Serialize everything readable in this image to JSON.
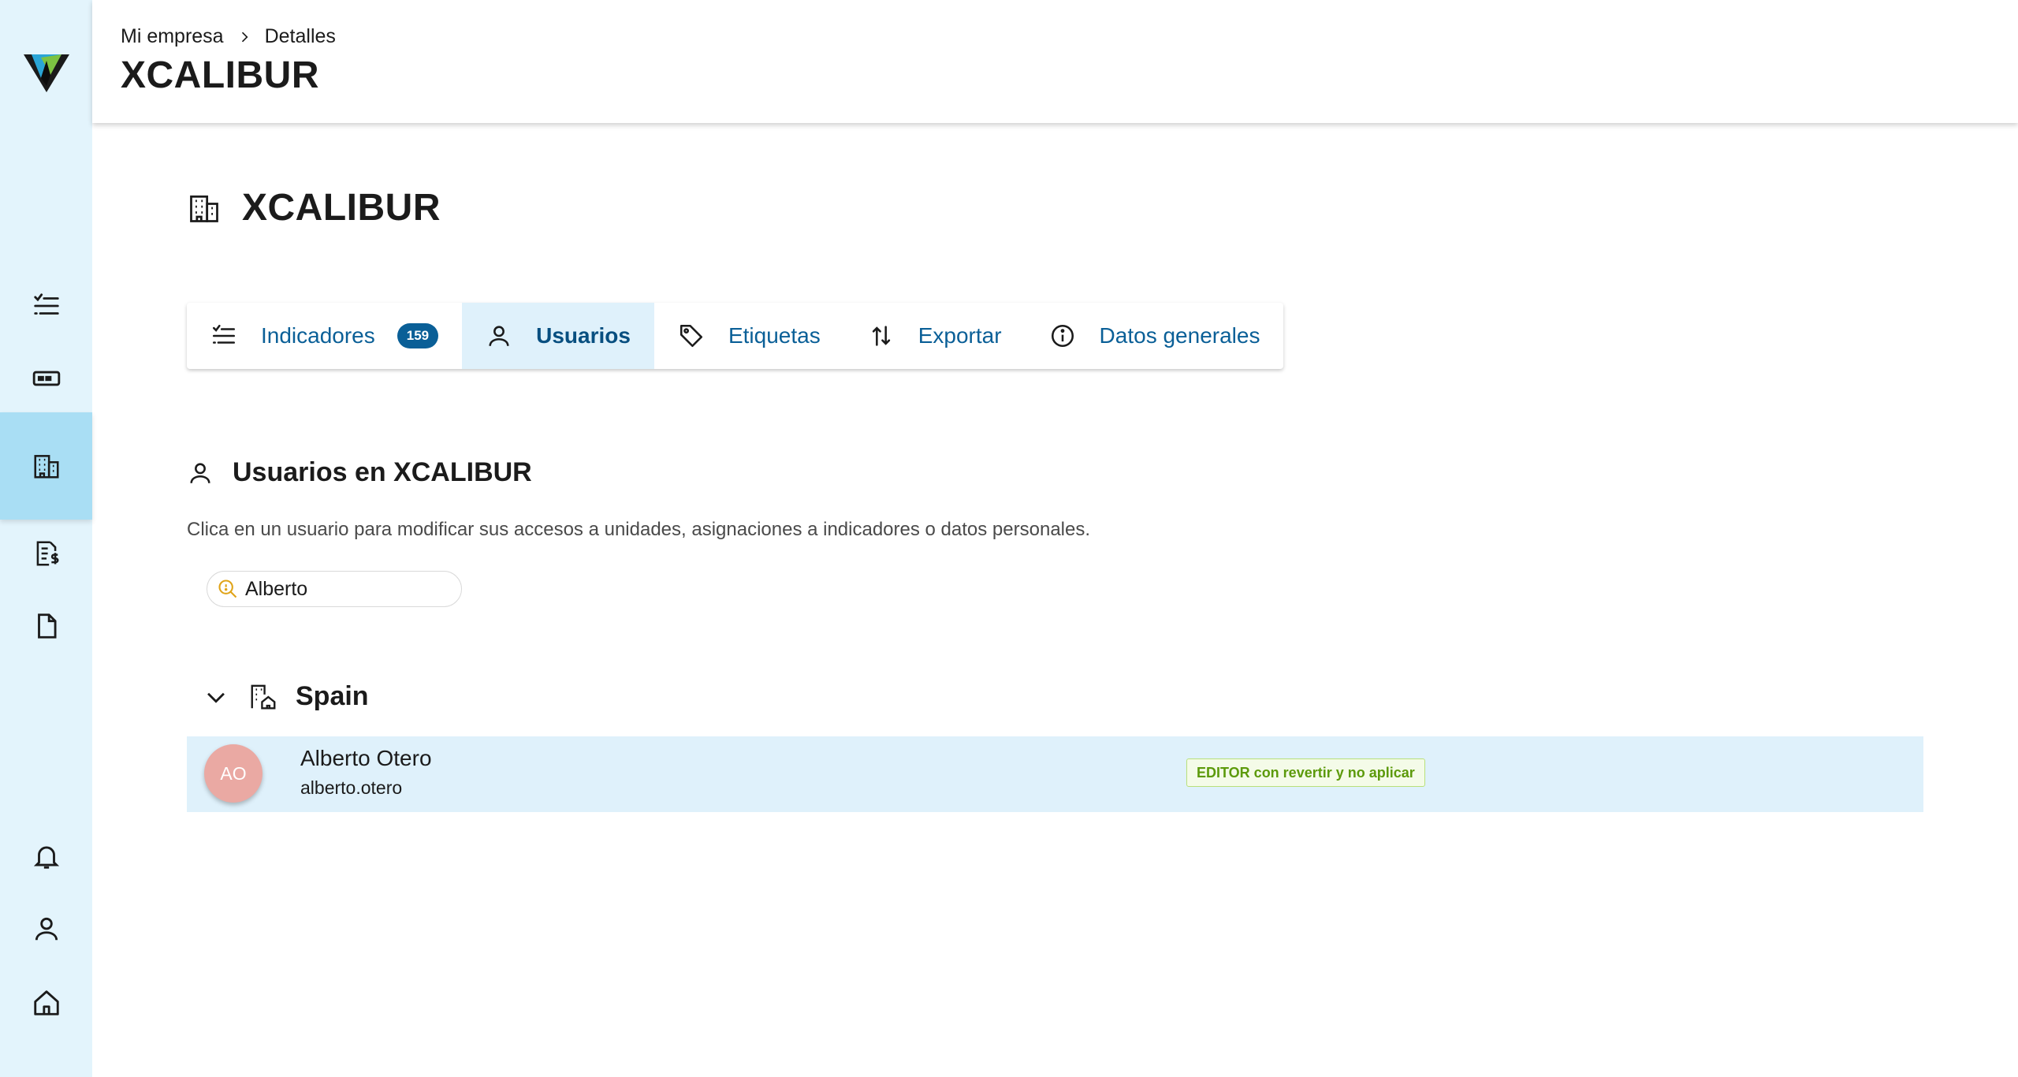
{
  "breadcrumb": {
    "parent": "Mi empresa",
    "current": "Detalles"
  },
  "header": {
    "title": "XCALIBUR"
  },
  "page": {
    "title": "XCALIBUR"
  },
  "tabs": [
    {
      "label": "Indicadores",
      "badge": "159",
      "icon": "checklist-icon"
    },
    {
      "label": "Usuarios",
      "icon": "user-icon",
      "active": true
    },
    {
      "label": "Etiquetas",
      "icon": "tag-icon"
    },
    {
      "label": "Exportar",
      "icon": "swap-vertical-icon"
    },
    {
      "label": "Datos generales",
      "icon": "info-icon"
    }
  ],
  "section": {
    "title": "Usuarios en XCALIBUR",
    "description": "Clica en un usuario para modificar sus accesos a unidades, asignaciones a indicadores o datos personales."
  },
  "search": {
    "value": "Alberto"
  },
  "group": {
    "name": "Spain"
  },
  "users": [
    {
      "initials": "AO",
      "name": "Alberto Otero",
      "login": "alberto.otero",
      "role": "EDITOR con revertir y no aplicar"
    }
  ],
  "colors": {
    "sidebar_bg": "#e3f4fc",
    "sidebar_active": "#a9def4",
    "accent": "#0a5f97",
    "row_highlight": "#dff1fb",
    "role_green": "#5c9a0b",
    "avatar": "#eaa9a3"
  }
}
